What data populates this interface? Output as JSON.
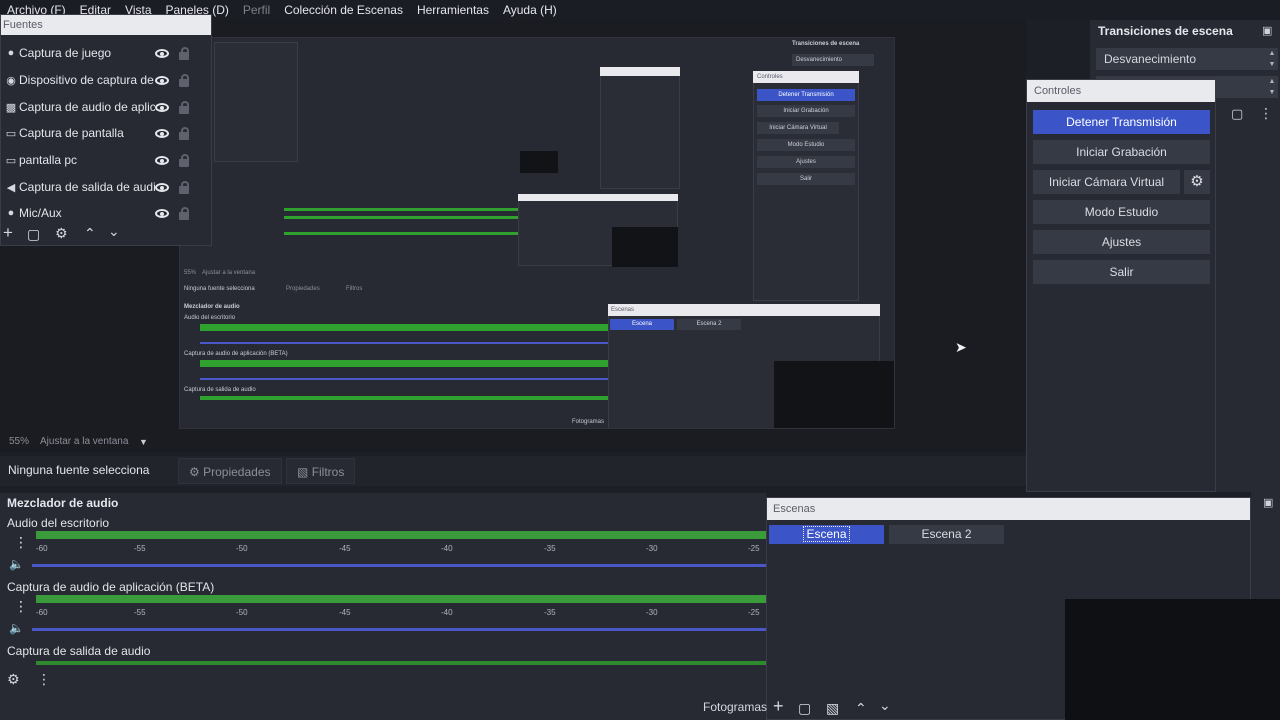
{
  "menu": {
    "items": [
      "Archivo (F)",
      "Editar",
      "Vista",
      "Paneles (D)",
      "Perfil",
      "Colección de Escenas",
      "Herramientas",
      "Ayuda (H)"
    ]
  },
  "sources": {
    "title": "Fuentes",
    "items": [
      {
        "label": "Captura de juego",
        "icon": "gamepad-icon"
      },
      {
        "label": "Dispositivo de captura de v",
        "icon": "camera-icon"
      },
      {
        "label": "Captura de audio de aplica",
        "icon": "app-audio-icon"
      },
      {
        "label": "Captura de pantalla",
        "icon": "monitor-icon"
      },
      {
        "label": "pantalla pc",
        "icon": "monitor-icon"
      },
      {
        "label": "Captura de salida de audio",
        "icon": "speaker-icon"
      },
      {
        "label": "Mic/Aux",
        "icon": "microphone-icon"
      }
    ]
  },
  "transitions": {
    "title": "Transiciones de escena",
    "selected": "Desvanecimiento"
  },
  "controls": {
    "title": "Controles",
    "stop_stream": "Detener Transmisión",
    "start_recording": "Iniciar Grabación",
    "start_virtual_cam": "Iniciar Cámara Virtual",
    "studio_mode": "Modo Estudio",
    "settings": "Ajustes",
    "exit": "Salir"
  },
  "preview": {
    "zoom": "55%",
    "fit": "Ajustar a la ventana"
  },
  "source_toolbar": {
    "no_source": "Ninguna fuente selecciona",
    "properties": "Propiedades",
    "filters": "Filtros"
  },
  "mixer": {
    "title": "Mezclador de audio",
    "channels": [
      {
        "name": "Audio del escritorio"
      },
      {
        "name": "Captura de audio de aplicación (BETA)"
      },
      {
        "name": "Captura de salida de audio"
      }
    ],
    "scale": [
      "-60",
      "-55",
      "-50",
      "-45",
      "-40",
      "-35",
      "-30",
      "-25"
    ]
  },
  "scenes": {
    "title": "Escenas",
    "items": [
      "Escena",
      "Escena 2"
    ],
    "selected": "Escena"
  },
  "bottom": {
    "framerate_label": "Fotogramas"
  },
  "nested": {
    "mixer_title": "Mezclador de audio",
    "ch1": "Audio del escritorio",
    "ch2": "Captura de audio de aplicación (BETA)",
    "ch3": "Captura de salida de audio",
    "no_source": "Ninguna fuente selecciona",
    "properties": "Propiedades",
    "filters": "Filtros",
    "zoom": "55%",
    "fit": "Ajustar a la ventana",
    "scenes_title": "Escenas",
    "scene1": "Escena",
    "scene2": "Escena 2",
    "transitions_title": "Transiciones de escena",
    "transition": "Desvanecimiento",
    "controls_title": "Controles",
    "fotogramas": "Fotogramas"
  },
  "colors": {
    "accent": "#3b55c9",
    "meter_green": "#3a9b3a",
    "volume_blue": "#4a57c8",
    "panel": "#272a33",
    "background": "#1d1f26"
  }
}
